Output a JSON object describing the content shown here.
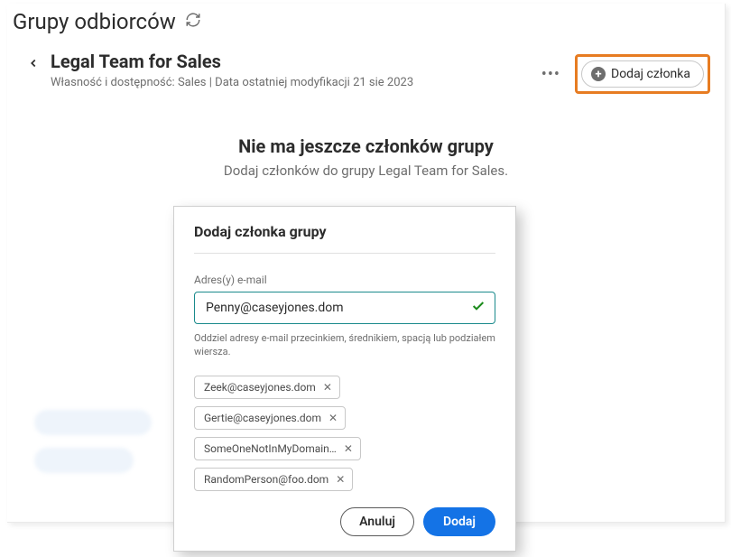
{
  "pageTitle": "Grupy odbiorców",
  "group": {
    "name": "Legal Team for Sales",
    "metaPrefix": "Własność i dostępność:",
    "owner": "Sales",
    "metaSep": "|",
    "modifiedLabel": "Data ostatniej modyfikacji",
    "modifiedDate": "21 sie 2023"
  },
  "addMemberButton": "Dodaj członka",
  "emptyState": {
    "title": "Nie ma jeszcze członków grupy",
    "subtitle": "Dodaj członków do grupy Legal Team for Sales."
  },
  "modal": {
    "title": "Dodaj członka grupy",
    "emailLabel": "Adres(y) e-mail",
    "emailValue": "Penny@caseyjones.dom",
    "hint": "Oddziel adresy e-mail przecinkiem, średnikiem, spacją lub podziałem wiersza.",
    "chips": [
      "Zeek@caseyjones.dom",
      "Gertie@caseyjones.dom",
      "SomeOneNotInMyDomain…",
      "RandomPerson@foo.dom"
    ],
    "cancel": "Anuluj",
    "add": "Dodaj"
  }
}
